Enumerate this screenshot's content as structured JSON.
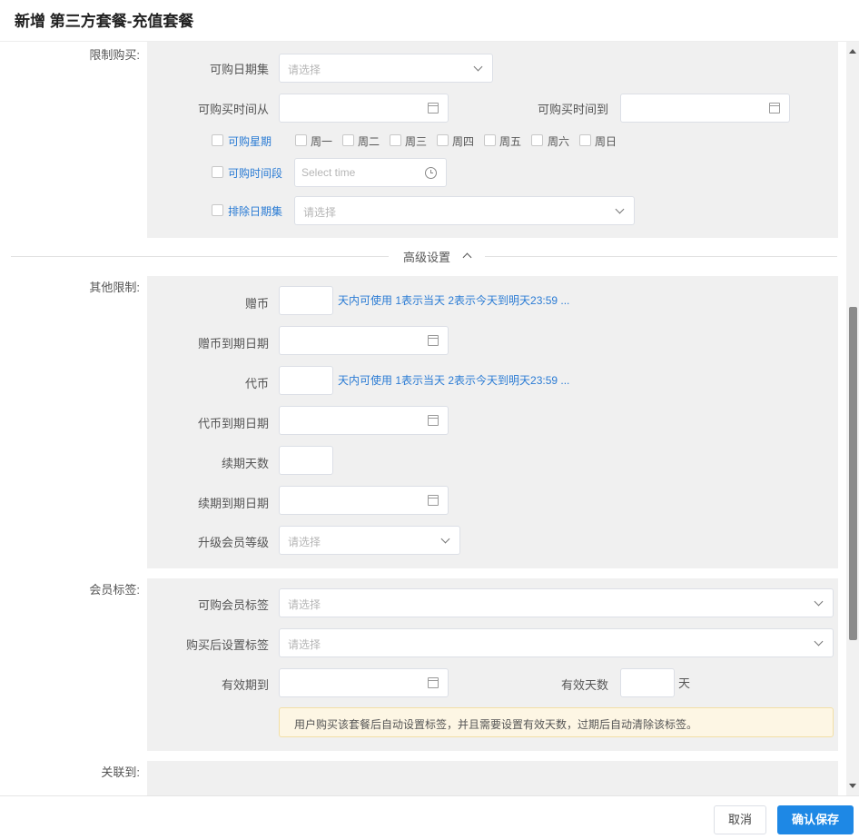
{
  "header": {
    "title": "新增 第三方套餐-充值套餐"
  },
  "limit_purchase": {
    "label": "限制购买:",
    "date_set": {
      "label": "可购日期集",
      "placeholder": "请选择"
    },
    "time_from": {
      "label": "可购买时间从"
    },
    "time_to": {
      "label": "可购买时间到"
    },
    "weekday": {
      "label": "可购星期",
      "days": [
        "周一",
        "周二",
        "周三",
        "周四",
        "周五",
        "周六",
        "周日"
      ]
    },
    "time_period": {
      "label": "可购时间段",
      "placeholder": "Select time"
    },
    "exclude_dates": {
      "label": "排除日期集",
      "placeholder": "请选择"
    }
  },
  "advanced": {
    "label": "高级设置"
  },
  "other_limits": {
    "label": "其他限制:",
    "bonus_coin": {
      "label": "赠币",
      "hint": "天内可使用 1表示当天 2表示今天到明天23:59 ..."
    },
    "bonus_expiry": {
      "label": "赠币到期日期"
    },
    "token": {
      "label": "代币",
      "hint": "天内可使用 1表示当天 2表示今天到明天23:59 ..."
    },
    "token_expiry": {
      "label": "代币到期日期"
    },
    "renew_days": {
      "label": "续期天数"
    },
    "renew_expiry": {
      "label": "续期到期日期"
    },
    "upgrade_level": {
      "label": "升级会员等级",
      "placeholder": "请选择"
    }
  },
  "member_tags": {
    "label": "会员标签:",
    "purchasable_tags": {
      "label": "可购会员标签",
      "placeholder": "请选择"
    },
    "after_purchase_tags": {
      "label": "购买后设置标签",
      "placeholder": "请选择"
    },
    "valid_until": {
      "label": "有效期到"
    },
    "valid_days": {
      "label": "有效天数",
      "unit": "天"
    },
    "notice": "用户购买该套餐后自动设置标签，并且需要设置有效天数，过期后自动清除该标签。"
  },
  "linked": {
    "label": "关联到:"
  },
  "footer": {
    "cancel": "取消",
    "save": "确认保存"
  }
}
